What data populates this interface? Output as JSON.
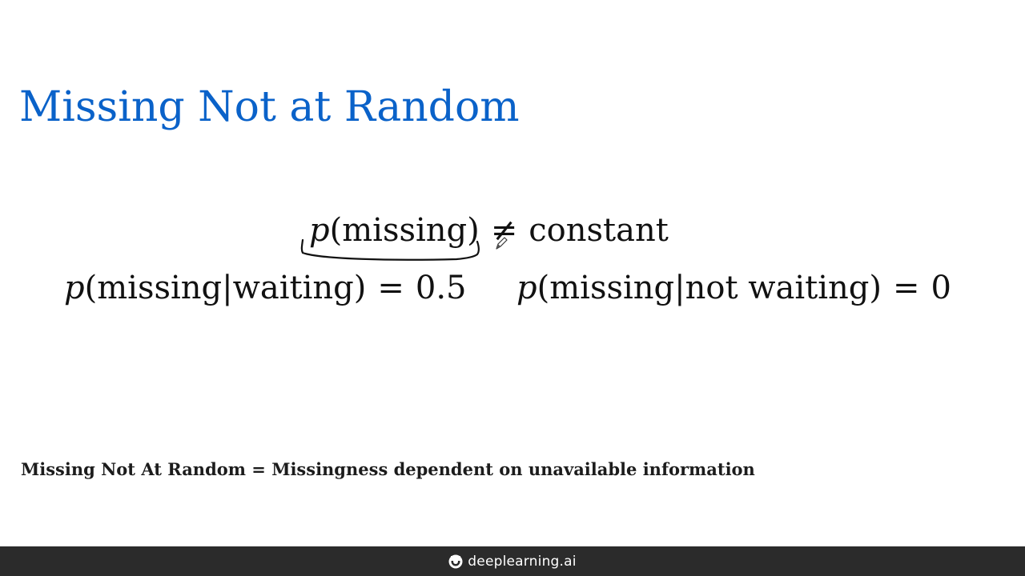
{
  "slide": {
    "title": "Missing Not at Random",
    "equations": {
      "main": {
        "p": "p",
        "arg": "missing",
        "op": "≠",
        "rhs": "constant"
      },
      "waiting": {
        "p": "p",
        "arg": "missing|waiting",
        "op": "=",
        "rhs": "0.5"
      },
      "not_waiting": {
        "p": "p",
        "arg": "missing|not waiting",
        "op": "=",
        "rhs": "0"
      }
    },
    "summary": "Missing Not At Random = Missingness dependent on unavailable information"
  },
  "footer": {
    "brand": "deeplearning.ai",
    "logo_icon": "deeplearning-logo-icon"
  },
  "colors": {
    "title": "#0a62c9",
    "text": "#111111",
    "footer_bg": "#2b2b2b",
    "footer_text": "#ffffff"
  }
}
